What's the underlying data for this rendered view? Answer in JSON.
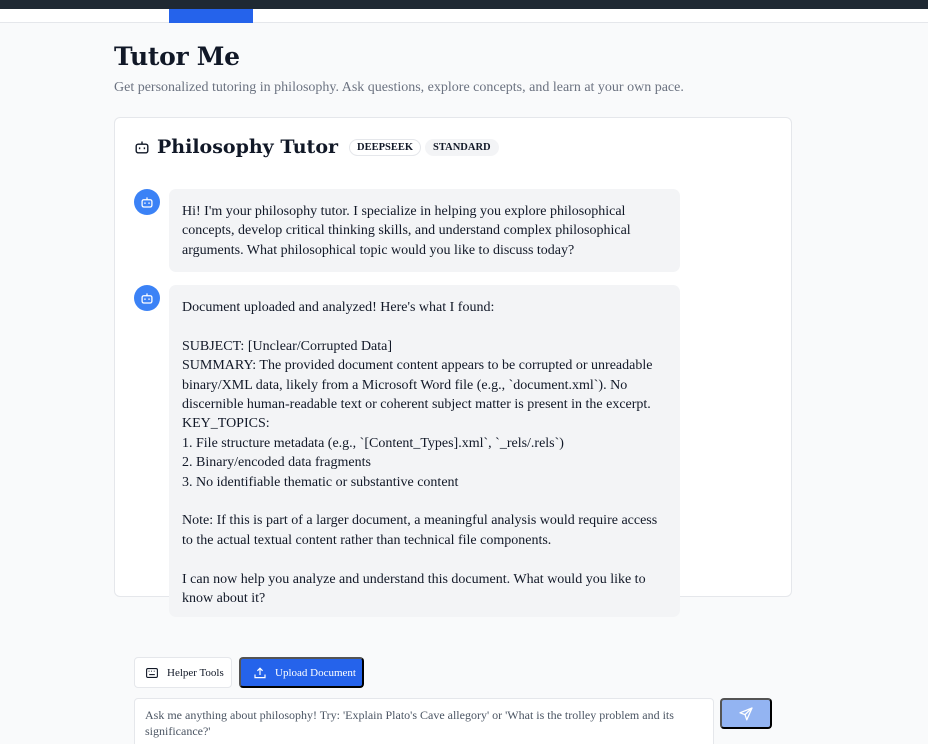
{
  "page": {
    "title": "Tutor Me",
    "subtitle": "Get personalized tutoring in philosophy. Ask questions, explore concepts, and learn at your own pace."
  },
  "card": {
    "title": "Philosophy Tutor",
    "badges": [
      "DEEPSEEK",
      "STANDARD"
    ]
  },
  "messages": [
    {
      "sender": "tutor",
      "text": "Hi! I'm your philosophy tutor. I specialize in helping you explore philosophical concepts, develop critical thinking skills, and understand complex philosophical arguments. What philosophical topic would you like to discuss today?"
    },
    {
      "sender": "tutor",
      "text": "Document uploaded and analyzed! Here's what I found:\n\nSUBJECT: [Unclear/Corrupted Data]\nSUMMARY: The provided document content appears to be corrupted or unreadable binary/XML data, likely from a Microsoft Word file (e.g., `document.xml`). No discernible human-readable text or coherent subject matter is present in the excerpt.\nKEY_TOPICS:\n1. File structure metadata (e.g., `[Content_Types].xml`, `_rels/.rels`)\n2. Binary/encoded data fragments\n3. No identifiable thematic or substantive content\n\nNote: If this is part of a larger document, a meaningful analysis would require access to the actual textual content rather than technical file components.\n\nI can now help you analyze and understand this document. What would you like to know about it?"
    }
  ],
  "toolbar": {
    "helper_label": "Helper Tools",
    "upload_label": "Upload Document"
  },
  "input": {
    "placeholder": "Ask me anything about philosophy! Try: 'Explain Plato's Cave allegory' or 'What is the trolley problem and its significance?'",
    "value": ""
  },
  "icons": {
    "bot": "bot-icon",
    "helper": "keyboard-icon",
    "upload": "upload-icon",
    "send": "send-icon"
  },
  "colors": {
    "accent": "#2563eb",
    "avatar": "#3b82f6",
    "send_disabled": "#93b4f2",
    "bubble": "#f3f4f6"
  }
}
